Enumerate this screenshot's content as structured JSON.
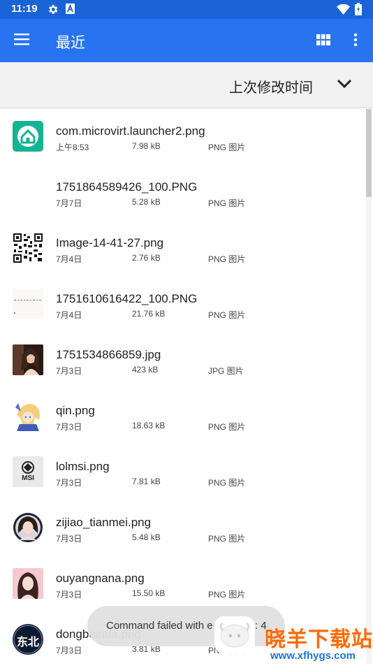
{
  "status_bar": {
    "time": "11:19"
  },
  "app_bar": {
    "title": "最近"
  },
  "sort_bar": {
    "label": "上次修改时间"
  },
  "files": [
    {
      "name": "com.microvirt.launcher2.png",
      "date": "上午8:53",
      "size": "7.98 kB",
      "type": "PNG 图片",
      "thumb": "launcher-icon"
    },
    {
      "name": "1751864589426_100.PNG",
      "date": "7月7日",
      "size": "5.28 kB",
      "type": "PNG 图片",
      "thumb": "blank"
    },
    {
      "name": "Image-14-41-27.png",
      "date": "7月4日",
      "size": "2.76 kB",
      "type": "PNG 图片",
      "thumb": "qr-code"
    },
    {
      "name": "1751610616422_100.PNG",
      "date": "7月4日",
      "size": "21.76 kB",
      "type": "PNG 图片",
      "thumb": "text-image"
    },
    {
      "name": "1751534866859.jpg",
      "date": "7月3日",
      "size": "423 kB",
      "type": "JPG 图片",
      "thumb": "photo"
    },
    {
      "name": "qin.png",
      "date": "7月3日",
      "size": "18.63 kB",
      "type": "PNG 图片",
      "thumb": "anime"
    },
    {
      "name": "lolmsi.png",
      "date": "7月3日",
      "size": "7.81 kB",
      "type": "PNG 图片",
      "thumb": "msi-logo"
    },
    {
      "name": "zijiao_tianmei.png",
      "date": "7月3日",
      "size": "5.48 kB",
      "type": "PNG 图片",
      "thumb": "portrait-circle"
    },
    {
      "name": "ouyangnana.png",
      "date": "7月3日",
      "size": "15.50 kB",
      "type": "PNG 图片",
      "thumb": "portrait"
    },
    {
      "name": "dongbeihua.png",
      "date": "7月3日",
      "size": "3.81 kB",
      "type": "PNG 图片",
      "thumb": "dongbei-badge"
    }
  ],
  "thumb_labels": {
    "msi": "MSI",
    "dongbei": "东北"
  },
  "toast": {
    "text": "Command failed with e",
    "suffix": ": 4"
  },
  "watermark": {
    "title": "晓羊下载站",
    "url": "www.xfhygs.com"
  },
  "colors": {
    "status_bar": "#1a63d6",
    "app_bar": "#2874f0",
    "sort_bar": "#f1f1f1",
    "watermark_orange": "#ff6a00",
    "watermark_blue": "#1b74d9"
  }
}
